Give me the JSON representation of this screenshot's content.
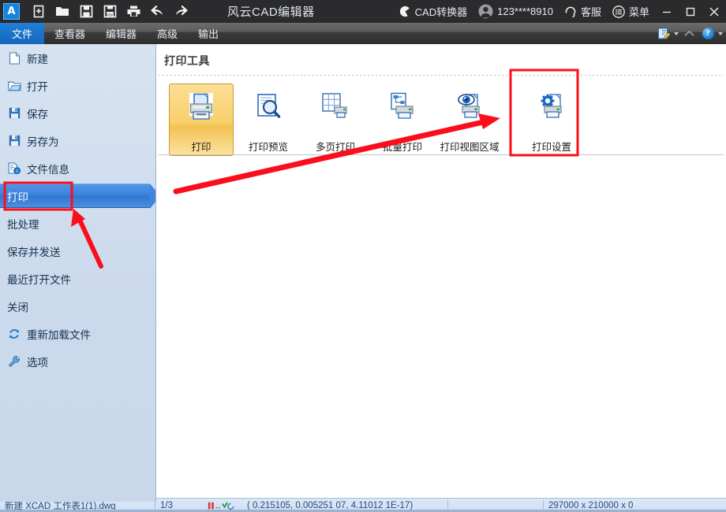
{
  "window": {
    "title": "风云CAD编辑器",
    "logo_icon": "cad-app-icon",
    "quick_access": [
      {
        "name": "new-file-icon",
        "label": "新建"
      },
      {
        "name": "open-folder-icon",
        "label": "打开"
      },
      {
        "name": "save-icon",
        "label": "保存"
      },
      {
        "name": "save-pdf-icon",
        "label": "另存为PDF"
      },
      {
        "name": "print-icon",
        "label": "打印"
      },
      {
        "name": "undo-icon",
        "label": "撤销"
      },
      {
        "name": "redo-icon",
        "label": "重做"
      }
    ],
    "right_items": [
      {
        "name": "cad-converter",
        "icon": "converter-icon",
        "label": "CAD转换器"
      },
      {
        "name": "user-account",
        "icon": "user-avatar-icon",
        "label": "123****8910"
      },
      {
        "name": "customer-service",
        "icon": "headset-icon",
        "label": "客服"
      },
      {
        "name": "menu",
        "icon": "hamburger-menu-icon",
        "label": "菜单"
      }
    ],
    "controls": {
      "minimize": "—",
      "maximize": "▢",
      "close": "✕"
    }
  },
  "ribbon": {
    "tabs": [
      {
        "label": "文件",
        "active": true
      },
      {
        "label": "查看器",
        "active": false
      },
      {
        "label": "编辑器",
        "active": false
      },
      {
        "label": "高级",
        "active": false
      },
      {
        "label": "输出",
        "active": false
      }
    ],
    "right_icons": [
      {
        "name": "edit-note-icon"
      },
      {
        "name": "collapse-ribbon-icon"
      },
      {
        "name": "help-icon",
        "glyph": "?"
      }
    ]
  },
  "sidebar": {
    "items": [
      {
        "label": "新建",
        "icon": "new-document-icon",
        "selected": false
      },
      {
        "label": "打开",
        "icon": "open-folder-icon",
        "selected": false
      },
      {
        "label": "保存",
        "icon": "floppy-save-icon",
        "selected": false
      },
      {
        "label": "另存为",
        "icon": "floppy-saveas-icon",
        "selected": false
      },
      {
        "label": "文件信息",
        "icon": "file-info-icon",
        "selected": false
      },
      {
        "label": "打印",
        "icon": "",
        "selected": true
      },
      {
        "label": "批处理",
        "icon": "",
        "selected": false
      },
      {
        "label": "保存并发送",
        "icon": "",
        "selected": false
      },
      {
        "label": "最近打开文件",
        "icon": "",
        "selected": false
      },
      {
        "label": "关闭",
        "icon": "",
        "selected": false
      },
      {
        "label": "重新加载文件",
        "icon": "reload-icon",
        "selected": false
      },
      {
        "label": "选项",
        "icon": "wrench-options-icon",
        "selected": false
      }
    ]
  },
  "content": {
    "section_title": "打印工具",
    "tiles": [
      {
        "label": "打印",
        "icon": "printer-document-icon",
        "active": true,
        "highlighted": false
      },
      {
        "label": "打印预览",
        "icon": "print-preview-magnifier-icon",
        "active": false,
        "highlighted": false
      },
      {
        "label": "多页打印",
        "icon": "multipage-print-icon",
        "active": false,
        "highlighted": false
      },
      {
        "label": "批量打印",
        "icon": "batch-print-icon",
        "active": false,
        "highlighted": false
      },
      {
        "label": "打印视图区域",
        "icon": "print-view-area-eye-icon",
        "active": false,
        "highlighted": false
      },
      {
        "label": "打印设置",
        "icon": "print-settings-gear-icon",
        "active": false,
        "highlighted": true
      }
    ]
  },
  "annotations": {
    "accent_red": "#fc0d1b",
    "arrow_to_print_settings": "红色箭头指向打印设置",
    "arrow_to_sidebar_print": "红色箭头指向左侧打印"
  },
  "statusbar": {
    "file": "新建 XCAD 工作表1(1).dwg",
    "page": "1/3",
    "coords": "( 0.215105, 0.005251 07, 4.11012 1E-17)",
    "extent": "297000 x 210000 x 0"
  }
}
